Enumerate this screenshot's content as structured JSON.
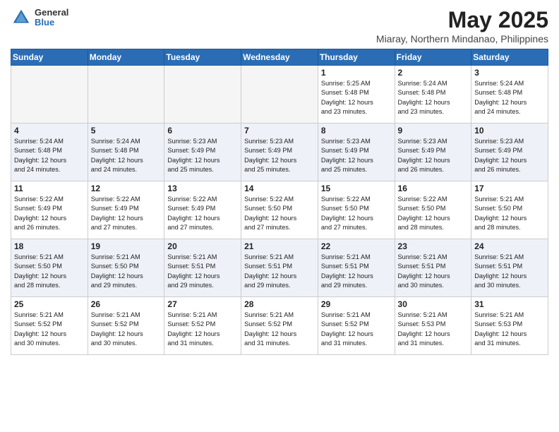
{
  "logo": {
    "general": "General",
    "blue": "Blue"
  },
  "title": "May 2025",
  "location": "Miaray, Northern Mindanao, Philippines",
  "weekdays": [
    "Sunday",
    "Monday",
    "Tuesday",
    "Wednesday",
    "Thursday",
    "Friday",
    "Saturday"
  ],
  "weeks": [
    [
      {
        "day": "",
        "info": ""
      },
      {
        "day": "",
        "info": ""
      },
      {
        "day": "",
        "info": ""
      },
      {
        "day": "",
        "info": ""
      },
      {
        "day": "1",
        "info": "Sunrise: 5:25 AM\nSunset: 5:48 PM\nDaylight: 12 hours\nand 23 minutes."
      },
      {
        "day": "2",
        "info": "Sunrise: 5:24 AM\nSunset: 5:48 PM\nDaylight: 12 hours\nand 23 minutes."
      },
      {
        "day": "3",
        "info": "Sunrise: 5:24 AM\nSunset: 5:48 PM\nDaylight: 12 hours\nand 24 minutes."
      }
    ],
    [
      {
        "day": "4",
        "info": "Sunrise: 5:24 AM\nSunset: 5:48 PM\nDaylight: 12 hours\nand 24 minutes."
      },
      {
        "day": "5",
        "info": "Sunrise: 5:24 AM\nSunset: 5:48 PM\nDaylight: 12 hours\nand 24 minutes."
      },
      {
        "day": "6",
        "info": "Sunrise: 5:23 AM\nSunset: 5:49 PM\nDaylight: 12 hours\nand 25 minutes."
      },
      {
        "day": "7",
        "info": "Sunrise: 5:23 AM\nSunset: 5:49 PM\nDaylight: 12 hours\nand 25 minutes."
      },
      {
        "day": "8",
        "info": "Sunrise: 5:23 AM\nSunset: 5:49 PM\nDaylight: 12 hours\nand 25 minutes."
      },
      {
        "day": "9",
        "info": "Sunrise: 5:23 AM\nSunset: 5:49 PM\nDaylight: 12 hours\nand 26 minutes."
      },
      {
        "day": "10",
        "info": "Sunrise: 5:23 AM\nSunset: 5:49 PM\nDaylight: 12 hours\nand 26 minutes."
      }
    ],
    [
      {
        "day": "11",
        "info": "Sunrise: 5:22 AM\nSunset: 5:49 PM\nDaylight: 12 hours\nand 26 minutes."
      },
      {
        "day": "12",
        "info": "Sunrise: 5:22 AM\nSunset: 5:49 PM\nDaylight: 12 hours\nand 27 minutes."
      },
      {
        "day": "13",
        "info": "Sunrise: 5:22 AM\nSunset: 5:49 PM\nDaylight: 12 hours\nand 27 minutes."
      },
      {
        "day": "14",
        "info": "Sunrise: 5:22 AM\nSunset: 5:50 PM\nDaylight: 12 hours\nand 27 minutes."
      },
      {
        "day": "15",
        "info": "Sunrise: 5:22 AM\nSunset: 5:50 PM\nDaylight: 12 hours\nand 27 minutes."
      },
      {
        "day": "16",
        "info": "Sunrise: 5:22 AM\nSunset: 5:50 PM\nDaylight: 12 hours\nand 28 minutes."
      },
      {
        "day": "17",
        "info": "Sunrise: 5:21 AM\nSunset: 5:50 PM\nDaylight: 12 hours\nand 28 minutes."
      }
    ],
    [
      {
        "day": "18",
        "info": "Sunrise: 5:21 AM\nSunset: 5:50 PM\nDaylight: 12 hours\nand 28 minutes."
      },
      {
        "day": "19",
        "info": "Sunrise: 5:21 AM\nSunset: 5:50 PM\nDaylight: 12 hours\nand 29 minutes."
      },
      {
        "day": "20",
        "info": "Sunrise: 5:21 AM\nSunset: 5:51 PM\nDaylight: 12 hours\nand 29 minutes."
      },
      {
        "day": "21",
        "info": "Sunrise: 5:21 AM\nSunset: 5:51 PM\nDaylight: 12 hours\nand 29 minutes."
      },
      {
        "day": "22",
        "info": "Sunrise: 5:21 AM\nSunset: 5:51 PM\nDaylight: 12 hours\nand 29 minutes."
      },
      {
        "day": "23",
        "info": "Sunrise: 5:21 AM\nSunset: 5:51 PM\nDaylight: 12 hours\nand 30 minutes."
      },
      {
        "day": "24",
        "info": "Sunrise: 5:21 AM\nSunset: 5:51 PM\nDaylight: 12 hours\nand 30 minutes."
      }
    ],
    [
      {
        "day": "25",
        "info": "Sunrise: 5:21 AM\nSunset: 5:52 PM\nDaylight: 12 hours\nand 30 minutes."
      },
      {
        "day": "26",
        "info": "Sunrise: 5:21 AM\nSunset: 5:52 PM\nDaylight: 12 hours\nand 30 minutes."
      },
      {
        "day": "27",
        "info": "Sunrise: 5:21 AM\nSunset: 5:52 PM\nDaylight: 12 hours\nand 31 minutes."
      },
      {
        "day": "28",
        "info": "Sunrise: 5:21 AM\nSunset: 5:52 PM\nDaylight: 12 hours\nand 31 minutes."
      },
      {
        "day": "29",
        "info": "Sunrise: 5:21 AM\nSunset: 5:52 PM\nDaylight: 12 hours\nand 31 minutes."
      },
      {
        "day": "30",
        "info": "Sunrise: 5:21 AM\nSunset: 5:53 PM\nDaylight: 12 hours\nand 31 minutes."
      },
      {
        "day": "31",
        "info": "Sunrise: 5:21 AM\nSunset: 5:53 PM\nDaylight: 12 hours\nand 31 minutes."
      }
    ]
  ]
}
